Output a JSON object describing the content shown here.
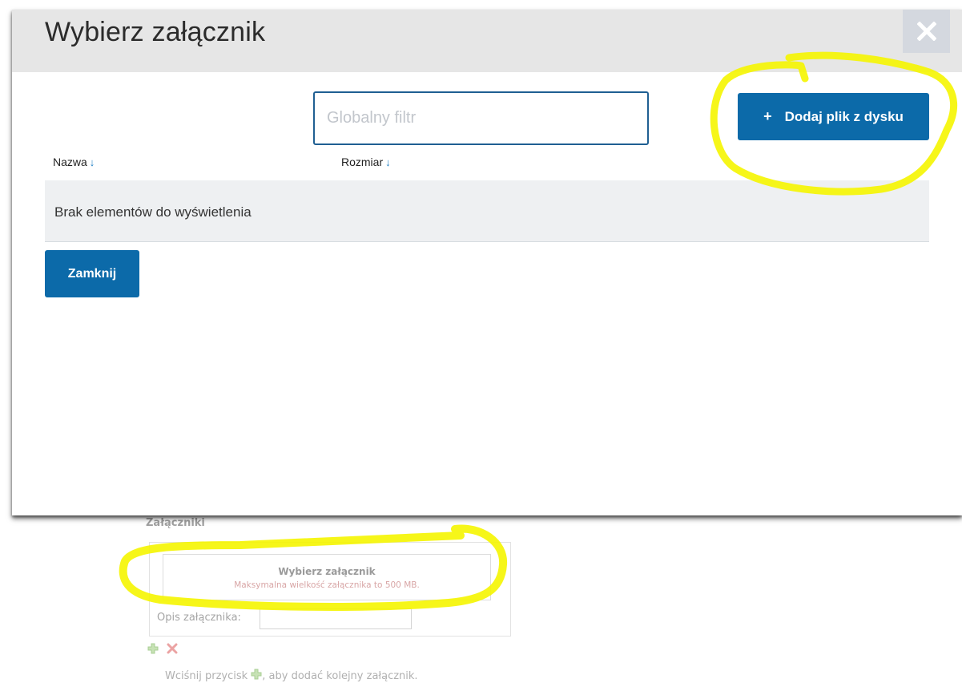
{
  "background_page": {
    "section_title": "Załączniki",
    "choose_title": "Wybierz załącznik",
    "max_size_note": "Maksymalna wielkość załącznika to 500 MB.",
    "description_label": "Opis załącznika:",
    "description_value": "",
    "hint_before": "Wciśnij przycisk",
    "hint_after": ", aby dodać kolejny załącznik."
  },
  "modal": {
    "title": "Wybierz załącznik",
    "close_symbol": "✕",
    "filter": {
      "placeholder": "Globalny filtr",
      "value": ""
    },
    "add_button": {
      "icon": "+",
      "label": "Dodaj plik z dysku"
    },
    "columns": [
      {
        "label": "Nazwa",
        "sort_icon": "↓"
      },
      {
        "label": "Rozmiar",
        "sort_icon": "↓"
      }
    ],
    "empty_message": "Brak elementów do wyświetlenia",
    "close_button_label": "Zamknij"
  },
  "colors": {
    "primary": "#0c6aa9",
    "header_bg": "#e6e6e6",
    "highlight": "#f5f500",
    "sort_arrow": "#1e7fc4"
  }
}
